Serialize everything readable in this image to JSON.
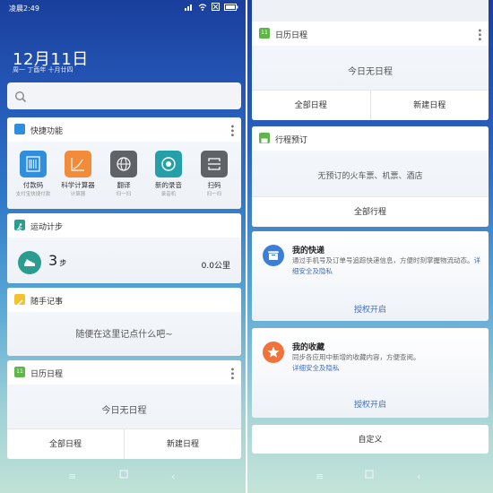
{
  "status": {
    "time": "凌晨2:49"
  },
  "left": {
    "date": "12月11日",
    "lunar": "周一 丁酉年 十月廿四",
    "quick": {
      "title": "快捷功能",
      "items": [
        {
          "label": "付款码",
          "sub": "支付宝快捷付款",
          "color": "#2f8fdd"
        },
        {
          "label": "科学计算器",
          "sub": "计算器",
          "color": "#f28b3a"
        },
        {
          "label": "翻译",
          "sub": "扫一扫",
          "color": "#5f6368"
        },
        {
          "label": "新的录音",
          "sub": "录音机",
          "color": "#26a0a8"
        },
        {
          "label": "扫码",
          "sub": "扫一扫",
          "color": "#5f6368"
        }
      ]
    },
    "steps": {
      "title": "运动计步",
      "count": "3",
      "unit": "步",
      "distance": "0.0公里"
    },
    "notes": {
      "title": "随手记事",
      "placeholder": "随便在这里记点什么吧~"
    },
    "calendar": {
      "badge": "11",
      "title": "日历日程",
      "empty": "今日无日程",
      "btn_all": "全部日程",
      "btn_new": "新建日程"
    }
  },
  "right": {
    "calendar": {
      "badge": "11",
      "title": "日历日程",
      "empty": "今日无日程",
      "btn_all": "全部日程",
      "btn_new": "新建日程"
    },
    "trip": {
      "title": "行程预订",
      "empty": "无预订的火车票、机票、酒店",
      "btn_all": "全部行程"
    },
    "express": {
      "title": "我的快递",
      "desc": "通过手机号及订单号追踪快递信息，方便时刻掌握物流动态。",
      "link": "详细安全及隐私",
      "auth": "授权开启"
    },
    "fav": {
      "title": "我的收藏",
      "desc": "同步各应用中新增的收藏内容，方便查阅。",
      "link": "详细安全及隐私",
      "auth": "授权开启"
    },
    "customize": "自定义"
  },
  "colors": {
    "accent": "#2f8fdd",
    "step": "#2a9d8f",
    "notes": "#f2c230",
    "trip": "#5fb548",
    "express": "#3d7fd6",
    "fav": "#f0733a"
  }
}
